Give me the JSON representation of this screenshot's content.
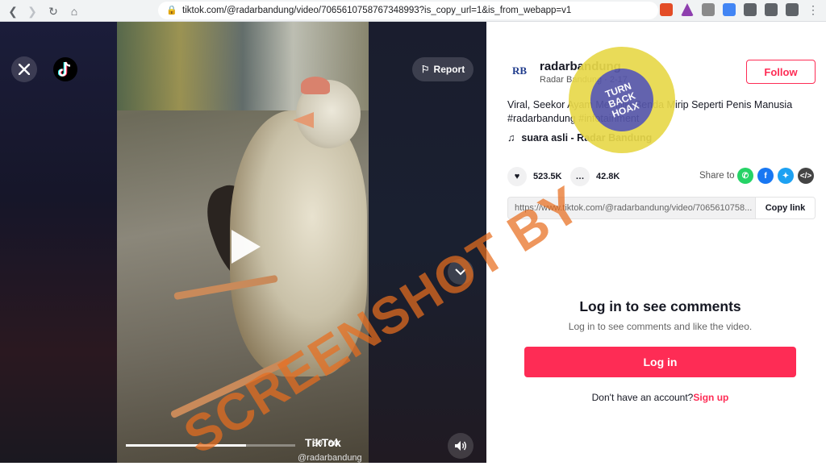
{
  "browser": {
    "url": "tiktok.com/@radarbandung/video/7065610758767348993?is_copy_url=1&is_from_webapp=v1",
    "back_icon": "back-icon",
    "forward_icon": "forward-icon",
    "reload_icon": "reload-icon",
    "home_icon": "home-icon"
  },
  "video": {
    "report_label": "Report",
    "time": "00:00",
    "watermark_brand": "TikTok",
    "watermark_handle": "@radarbandung",
    "progress_percent": 71
  },
  "profile": {
    "avatar_text": "RB",
    "username": "radarbandung",
    "subname": "Radar Bandung · 2-17",
    "follow_label": "Follow"
  },
  "post": {
    "description": "Viral, Seekor Ayam Memiliki Benda Mirip Seperti Penis Manusia #radarbandung #infotainment",
    "music": "suara asli - Radar Bandung",
    "likes": "523.5K",
    "comments": "42.8K",
    "share_label": "Share to",
    "link": "https://www.tiktok.com/@radarbandung/video/7065610758...",
    "copy_label": "Copy link"
  },
  "comments_panel": {
    "title": "Log in to see comments",
    "subtitle": "Log in to see comments and like the video.",
    "login_label": "Log in",
    "no_account": "Don't have an account?",
    "signup_label": "Sign up"
  },
  "overlay": {
    "watermark": "SCREENSHOT BY",
    "badge_line1": "TURN",
    "badge_line2": "BACK",
    "badge_line3": "HOAX"
  },
  "colors": {
    "tiktok_red": "#fe2c55",
    "watermark_orange": "#e76e1e",
    "badge_yellow": "#e8d84a",
    "badge_purple": "#5656a8"
  }
}
